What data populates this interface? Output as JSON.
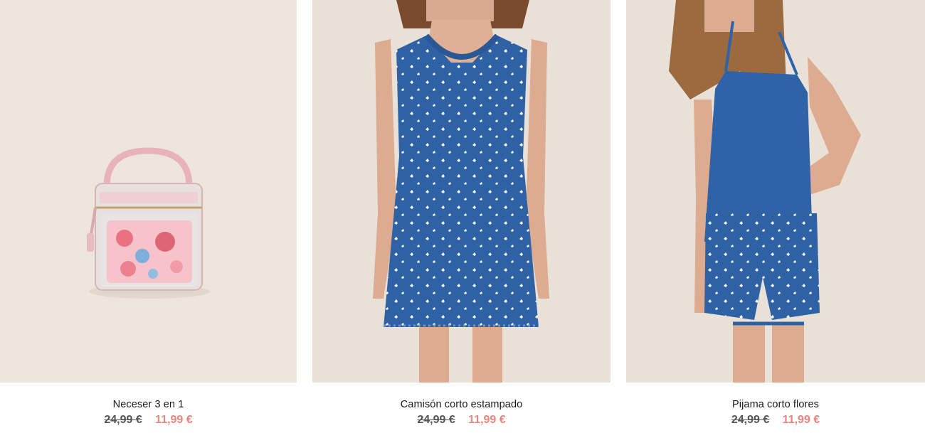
{
  "products": [
    {
      "name": "Neceser 3 en 1",
      "old_price": "24,99 €",
      "new_price": "11,99 €",
      "image": "toiletry-bag-image"
    },
    {
      "name": "Camisón corto estampado",
      "old_price": "24,99 €",
      "new_price": "11,99 €",
      "image": "nightdress-image"
    },
    {
      "name": "Pijama corto flores",
      "old_price": "24,99 €",
      "new_price": "11,99 €",
      "image": "pajama-image"
    }
  ],
  "colors": {
    "photo_background": "#ede5dc",
    "sale_price": "#e8857e",
    "old_price": "#555555",
    "garment_blue": "#2f62a5"
  }
}
